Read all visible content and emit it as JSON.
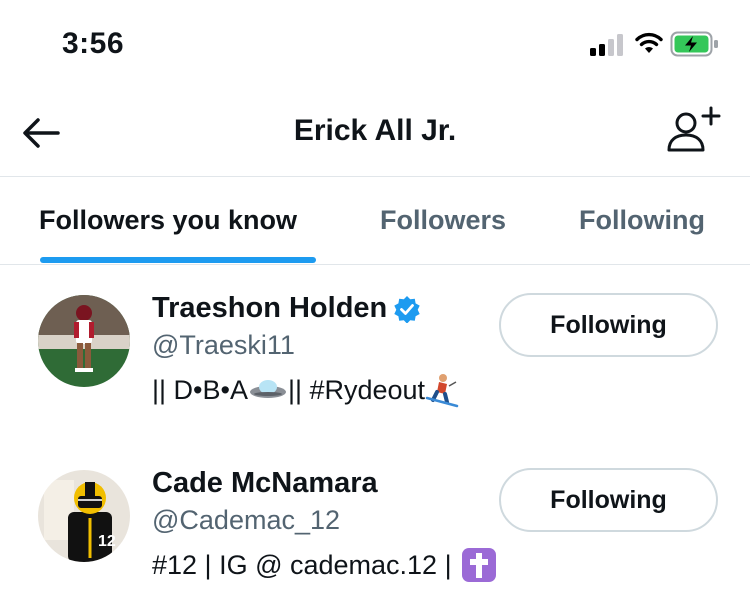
{
  "status_bar": {
    "time": "3:56",
    "signal_icon": "cellular-signal-icon",
    "wifi_icon": "wifi-icon",
    "battery_icon": "battery-charging-icon",
    "battery_color": "#34c759"
  },
  "header": {
    "title": "Erick All Jr.",
    "back_icon": "arrow-left-icon",
    "add_user_icon": "add-user-icon"
  },
  "tabs": [
    {
      "label": "Followers you know",
      "active": true
    },
    {
      "label": "Followers",
      "active": false
    },
    {
      "label": "Following",
      "active": false
    }
  ],
  "accent_color": "#1d9bf0",
  "users": [
    {
      "name": "Traeshon Holden",
      "verified": true,
      "handle": "@Traeski11",
      "bio_text": "|| D•B•A",
      "bio_text_2": "|| #Rydeout",
      "bio_emojis": [
        "flying-saucer-emoji",
        "skier-emoji"
      ],
      "button_label": "Following"
    },
    {
      "name": "Cade McNamara",
      "verified": false,
      "handle": "@Cademac_12",
      "bio_text": "#12 | IG @ cademac.12 |",
      "bio_emojis": [
        "latin-cross-emoji"
      ],
      "button_label": "Following"
    }
  ]
}
